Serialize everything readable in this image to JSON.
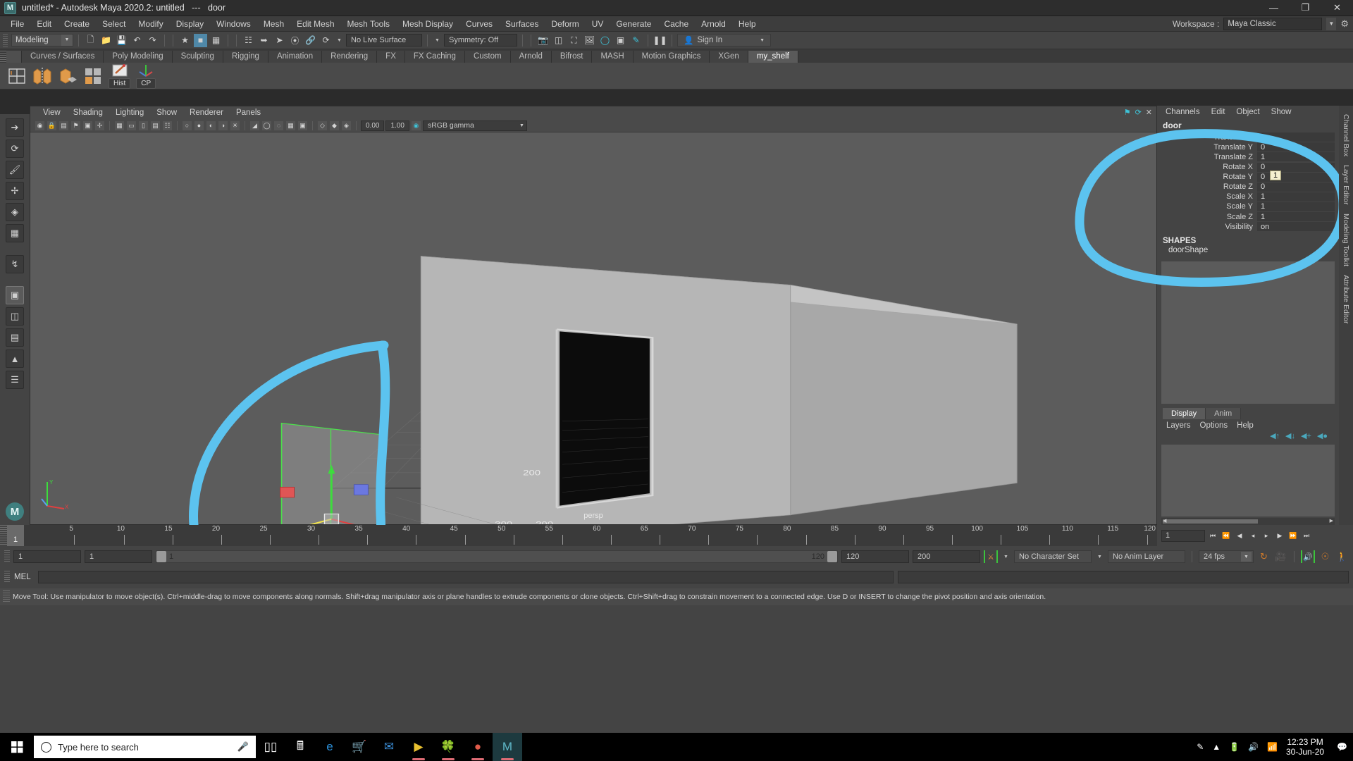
{
  "window": {
    "title": "untitled* - Autodesk Maya 2020.2: untitled   ---   door",
    "logo": "M",
    "minimize": "—",
    "maximize": "❐",
    "close": "✕"
  },
  "menubar": {
    "items": [
      "File",
      "Edit",
      "Create",
      "Select",
      "Modify",
      "Display",
      "Windows",
      "Mesh",
      "Edit Mesh",
      "Mesh Tools",
      "Mesh Display",
      "Curves",
      "Surfaces",
      "Deform",
      "UV",
      "Generate",
      "Cache",
      "Arnold",
      "Help"
    ],
    "workspace_label": "Workspace :",
    "workspace_value": "Maya Classic",
    "gear_icon": "gear-icon"
  },
  "statusline": {
    "menuset": "Modeling",
    "live_surface": "No Live Surface",
    "symmetry": "Symmetry: Off",
    "signin": "Sign In",
    "icons": [
      "new-scene-icon",
      "open-scene-icon",
      "save-scene-icon",
      "undo-icon",
      "redo-icon",
      "select-hierarchy-icon",
      "select-object-icon",
      "select-component-icon",
      "snap-grid-icon",
      "snap-curve-icon",
      "snap-point-icon",
      "snap-projected-icon",
      "snap-view-plane-icon",
      "magnet-icon",
      "render-icon",
      "ipr-icon",
      "render-settings-icon",
      "hypershade-icon",
      "render-view-icon",
      "pause-icon",
      "user-icon"
    ]
  },
  "shelf": {
    "tabs": [
      "Curves / Surfaces",
      "Poly Modeling",
      "Sculpting",
      "Rigging",
      "Animation",
      "Rendering",
      "FX",
      "FX Caching",
      "Custom",
      "Arnold",
      "Bifrost",
      "MASH",
      "Motion Graphics",
      "XGen",
      "my_shelf"
    ],
    "active_tab": "my_shelf",
    "buttons": [
      "Hist",
      "CP"
    ],
    "icons": [
      "grid-icon",
      "mirror-icon",
      "extrude-icon",
      "quad-draw-icon",
      "pencil-icon",
      "axis-icon"
    ]
  },
  "toolbox": {
    "tools": [
      "select-tool-icon",
      "lasso-select-icon",
      "paint-select-icon",
      "move-tool-icon",
      "rotate-tool-icon",
      "scale-tool-icon",
      "last-tool-icon",
      "snap-icon",
      "four-view-icon",
      "persp-view-icon",
      "outliner-view-icon",
      "hypergraph-view-icon",
      "maya-logo-icon"
    ]
  },
  "viewport": {
    "menus": [
      "View",
      "Shading",
      "Lighting",
      "Show",
      "Renderer",
      "Panels"
    ],
    "gamma": "sRGB gamma",
    "num_a": "0.00",
    "num_b": "1.00",
    "camera_label": "persp",
    "grid_labels": [
      "200",
      "200",
      "300"
    ],
    "axis": {
      "x": "X",
      "y": "Y",
      "z": "Z"
    }
  },
  "channelbox": {
    "menus": [
      "Channels",
      "Edit",
      "Object",
      "Show"
    ],
    "object_name": "door",
    "attributes": [
      {
        "name": "Translate X",
        "value": "0"
      },
      {
        "name": "Translate Y",
        "value": "0"
      },
      {
        "name": "Translate Z",
        "value": "1"
      },
      {
        "name": "Rotate X",
        "value": "0"
      },
      {
        "name": "Rotate Y",
        "value": "0"
      },
      {
        "name": "Rotate Z",
        "value": "0"
      },
      {
        "name": "Scale X",
        "value": "1"
      },
      {
        "name": "Scale Y",
        "value": "1"
      },
      {
        "name": "Scale Z",
        "value": "1"
      },
      {
        "name": "Visibility",
        "value": "on"
      }
    ],
    "shapes_header": "SHAPES",
    "shape_name": "doorShape",
    "tooltip_value": "1"
  },
  "layer_editor": {
    "tabs": [
      "Display",
      "Anim"
    ],
    "active_tab": "Display",
    "menus": [
      "Layers",
      "Options",
      "Help"
    ],
    "buttons": [
      "move-layer-up-icon",
      "move-layer-down-icon",
      "new-layer-icon",
      "new-layer-from-selected-icon"
    ]
  },
  "vertical_tabs": [
    "Channel Box",
    "Layer Editor",
    "Modeling Toolkit",
    "Attribute Editor"
  ],
  "timeline": {
    "current_frame": "1",
    "ticks": [
      "5",
      "10",
      "15",
      "20",
      "25",
      "30",
      "35",
      "40",
      "45",
      "50",
      "55",
      "60",
      "65",
      "70",
      "75",
      "80",
      "85",
      "90",
      "95",
      "100",
      "105",
      "110",
      "115",
      "120"
    ],
    "playback_field": "1",
    "transport": [
      "go-to-start-icon",
      "step-back-key-icon",
      "step-back-frame-icon",
      "play-backwards-icon",
      "play-forwards-icon",
      "step-forward-frame-icon",
      "step-forward-key-icon",
      "go-to-end-icon"
    ]
  },
  "rangeslider": {
    "anim_start": "1",
    "range_start": "1",
    "range_end": "120",
    "playback_end": "120",
    "anim_end": "200",
    "character_set": "No Character Set",
    "anim_layer": "No Anim Layer",
    "fps": "24 fps",
    "icons": [
      "auto-key-icon",
      "loop-icon",
      "animation-preferences-icon",
      "sound-icon",
      "key-icon",
      "walk-icon"
    ]
  },
  "command_line": {
    "label": "MEL",
    "value": "",
    "placeholder": ""
  },
  "help_line": {
    "text": "Move Tool: Use manipulator to move object(s). Ctrl+middle-drag to move components along normals. Shift+drag manipulator axis or plane handles to extrude components or clone objects. Ctrl+Shift+drag to constrain movement to a connected edge. Use D or INSERT to change the pivot position and axis orientation."
  },
  "taskbar": {
    "search_placeholder": "Type here to search",
    "apps": [
      "task-view-icon",
      "calculator-icon",
      "edge-icon",
      "store-icon",
      "mail-icon",
      "media-player-icon",
      "plant-app-icon",
      "chrome-icon",
      "maya-icon"
    ],
    "tray": [
      "pen-icon",
      "chevron-up-icon",
      "battery-icon",
      "volume-icon",
      "network-icon"
    ],
    "time": "12:23 PM",
    "date": "30-Jun-20"
  },
  "colors": {
    "accent_blue": "#5bb8e8",
    "maya_teal": "#4aa8bd",
    "shelf_bg": "#4a4a4a",
    "panel_bg": "#444444",
    "viewport_bg": "#5b5b5b",
    "annotation": "#5cc3ef"
  }
}
